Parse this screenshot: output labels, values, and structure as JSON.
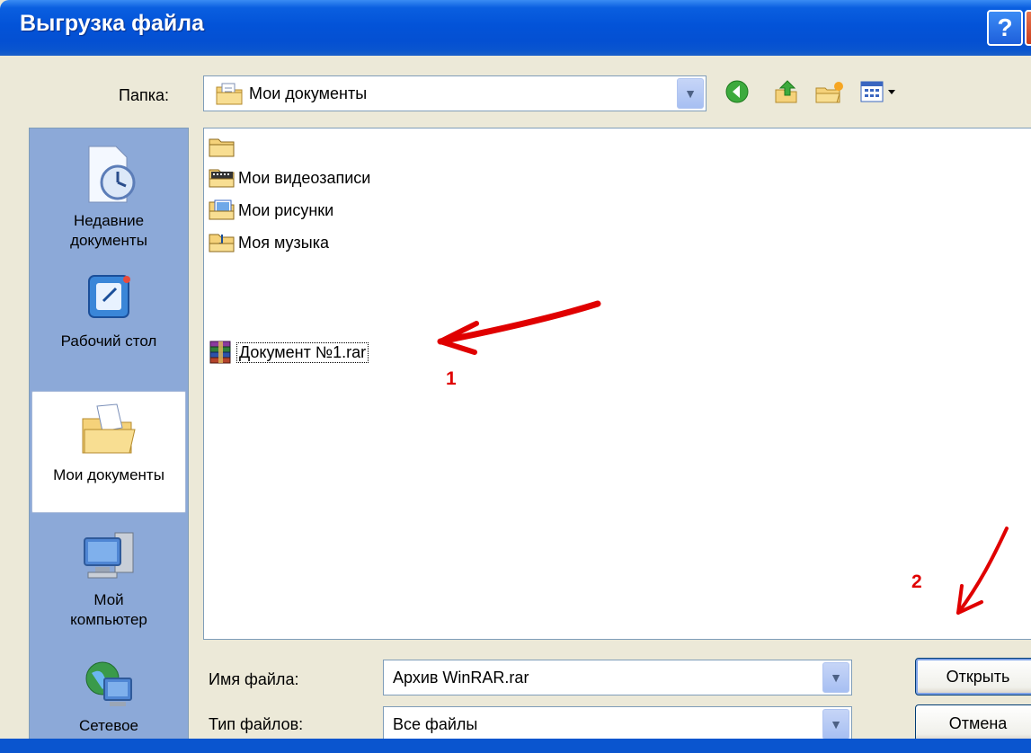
{
  "titlebar": {
    "title": "Выгрузка файла",
    "help_glyph": "?"
  },
  "lookin": {
    "label": "Папка:",
    "value": "Мои документы"
  },
  "toolbar": {
    "icons": [
      "back-icon",
      "up-folder-icon",
      "new-folder-icon",
      "view-menu-icon"
    ]
  },
  "places": [
    {
      "label": "Недавние\nдокументы",
      "icon": "recent-documents-icon"
    },
    {
      "label": "Рабочий стол",
      "icon": "desktop-icon"
    },
    {
      "label": "Мои документы",
      "icon": "my-documents-icon",
      "selected": true
    },
    {
      "label": "Мой\nкомпьютер",
      "icon": "my-computer-icon"
    },
    {
      "label": "Сетевое",
      "icon": "network-icon"
    }
  ],
  "files": [
    {
      "name": "",
      "icon": "folder-icon"
    },
    {
      "name": "Мои видеозаписи",
      "icon": "video-folder-icon"
    },
    {
      "name": "Мои рисунки",
      "icon": "pictures-folder-icon"
    },
    {
      "name": "Моя музыка",
      "icon": "music-folder-icon"
    },
    {
      "name": "Документ №1.rar",
      "icon": "rar-archive-icon",
      "focused": true
    }
  ],
  "filename": {
    "label": "Имя файла:",
    "value": "Архив WinRAR.rar"
  },
  "filetype": {
    "label": "Тип файлов:",
    "value": "Все файлы"
  },
  "buttons": {
    "open": "Открыть",
    "cancel": "Отмена"
  },
  "annotations": {
    "marker1": "1",
    "marker2": "2",
    "color": "#E00000"
  }
}
